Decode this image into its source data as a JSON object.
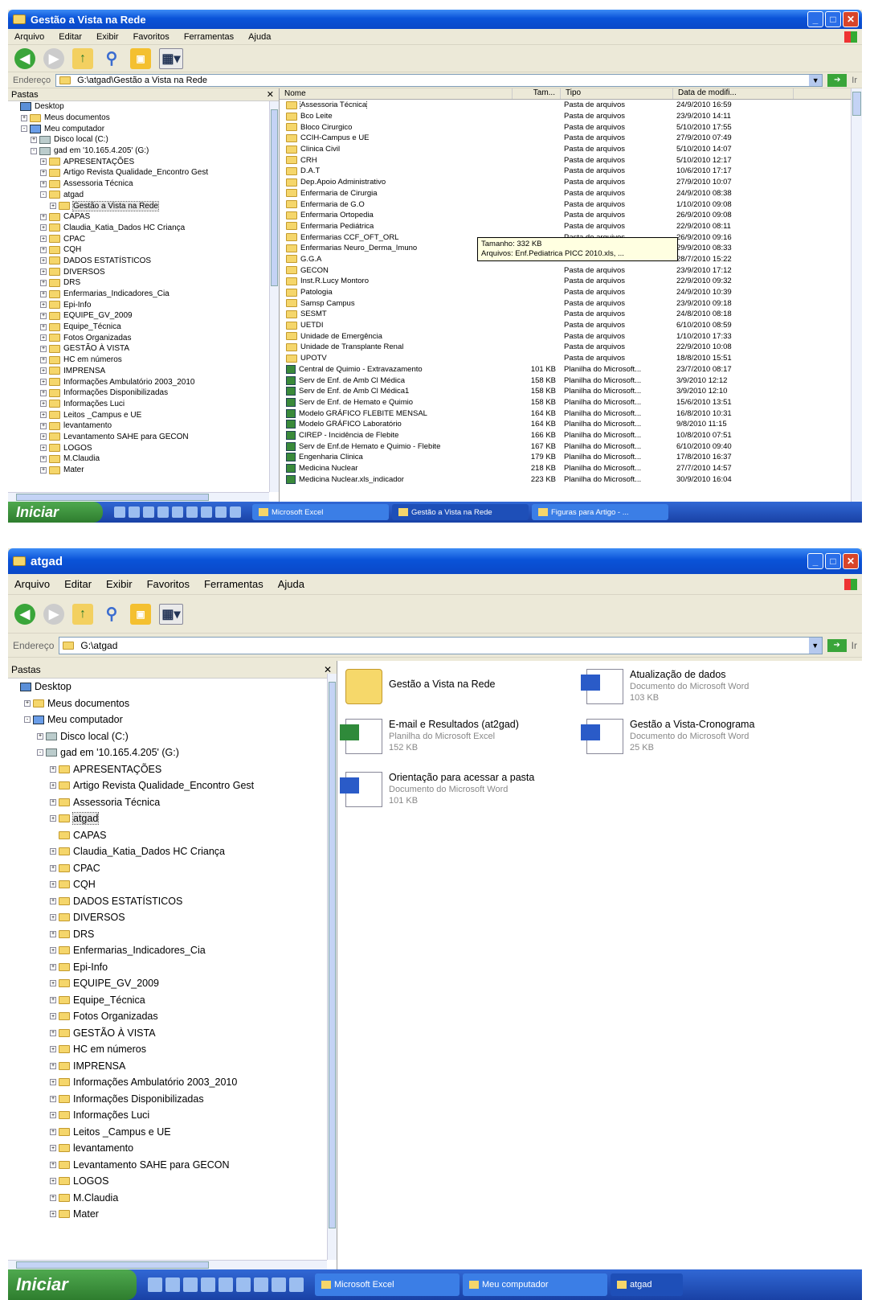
{
  "window1": {
    "title": "Gestão a Vista na Rede",
    "menu": [
      "Arquivo",
      "Editar",
      "Exibir",
      "Favoritos",
      "Ferramentas",
      "Ajuda"
    ],
    "address_label": "Endereço",
    "address": "G:\\atgad\\Gestão a Vista na Rede",
    "go_label": "Ir",
    "tree_header": "Pastas",
    "tree": [
      {
        "label": "Desktop",
        "level": 0,
        "icon": "desktop",
        "exp": ""
      },
      {
        "label": "Meus documentos",
        "level": 1,
        "icon": "folder",
        "exp": "+"
      },
      {
        "label": "Meu computador",
        "level": 1,
        "icon": "computer",
        "exp": "-"
      },
      {
        "label": "Disco local (C:)",
        "level": 2,
        "icon": "drive",
        "exp": "+"
      },
      {
        "label": "gad em '10.165.4.205' (G:)",
        "level": 2,
        "icon": "drive",
        "exp": "-"
      },
      {
        "label": "APRESENTAÇÕES",
        "level": 3,
        "icon": "folder",
        "exp": "+"
      },
      {
        "label": "Artigo Revista Qualidade_Encontro Gest",
        "level": 3,
        "icon": "folder",
        "exp": "+"
      },
      {
        "label": "Assessoria Técnica",
        "level": 3,
        "icon": "folder",
        "exp": "+"
      },
      {
        "label": "atgad",
        "level": 3,
        "icon": "folder",
        "exp": "-"
      },
      {
        "label": "Gestão a Vista na Rede",
        "level": 4,
        "icon": "folder",
        "exp": "+",
        "selected": true
      },
      {
        "label": "CAPAS",
        "level": 3,
        "icon": "folder",
        "exp": "+"
      },
      {
        "label": "Claudia_Katia_Dados HC Criança",
        "level": 3,
        "icon": "folder",
        "exp": "+"
      },
      {
        "label": "CPAC",
        "level": 3,
        "icon": "folder",
        "exp": "+"
      },
      {
        "label": "CQH",
        "level": 3,
        "icon": "folder",
        "exp": "+"
      },
      {
        "label": "DADOS ESTATÍSTICOS",
        "level": 3,
        "icon": "folder",
        "exp": "+"
      },
      {
        "label": "DIVERSOS",
        "level": 3,
        "icon": "folder",
        "exp": "+"
      },
      {
        "label": "DRS",
        "level": 3,
        "icon": "folder",
        "exp": "+"
      },
      {
        "label": "Enfermarias_Indicadores_Cia",
        "level": 3,
        "icon": "folder",
        "exp": "+"
      },
      {
        "label": "Epi-Info",
        "level": 3,
        "icon": "folder",
        "exp": "+"
      },
      {
        "label": "EQUIPE_GV_2009",
        "level": 3,
        "icon": "folder",
        "exp": "+"
      },
      {
        "label": "Equipe_Técnica",
        "level": 3,
        "icon": "folder",
        "exp": "+"
      },
      {
        "label": "Fotos Organizadas",
        "level": 3,
        "icon": "folder",
        "exp": "+"
      },
      {
        "label": "GESTÃO À VISTA",
        "level": 3,
        "icon": "folder",
        "exp": "+"
      },
      {
        "label": "HC em números",
        "level": 3,
        "icon": "folder",
        "exp": "+"
      },
      {
        "label": "IMPRENSA",
        "level": 3,
        "icon": "folder",
        "exp": "+"
      },
      {
        "label": "Informações Ambulatório 2003_2010",
        "level": 3,
        "icon": "folder",
        "exp": "+"
      },
      {
        "label": "Informações Disponibilizadas",
        "level": 3,
        "icon": "folder",
        "exp": "+"
      },
      {
        "label": "Informações Luci",
        "level": 3,
        "icon": "folder",
        "exp": "+"
      },
      {
        "label": "Leitos _Campus e UE",
        "level": 3,
        "icon": "folder",
        "exp": "+"
      },
      {
        "label": "levantamento",
        "level": 3,
        "icon": "folder",
        "exp": "+"
      },
      {
        "label": "Levantamento SAHE para GECON",
        "level": 3,
        "icon": "folder",
        "exp": "+"
      },
      {
        "label": "LOGOS",
        "level": 3,
        "icon": "folder",
        "exp": "+"
      },
      {
        "label": "M.Claudia",
        "level": 3,
        "icon": "folder",
        "exp": "+"
      },
      {
        "label": "Mater",
        "level": 3,
        "icon": "folder",
        "exp": "+"
      }
    ],
    "columns": [
      "Nome",
      "Tam...",
      "Tipo",
      "Data de modifi..."
    ],
    "files": [
      {
        "name": "Assessoria Técnica",
        "size": "",
        "type": "Pasta de arquivos",
        "date": "24/9/2010 16:59",
        "icon": "folder"
      },
      {
        "name": "Bco Leite",
        "size": "",
        "type": "Pasta de arquivos",
        "date": "23/9/2010 14:11",
        "icon": "folder"
      },
      {
        "name": "Bloco Cirurgico",
        "size": "",
        "type": "Pasta de arquivos",
        "date": "5/10/2010 17:55",
        "icon": "folder"
      },
      {
        "name": "CCIH-Campus e UE",
        "size": "",
        "type": "Pasta de arquivos",
        "date": "27/9/2010 07:49",
        "icon": "folder"
      },
      {
        "name": "Clinica Civil",
        "size": "",
        "type": "Pasta de arquivos",
        "date": "5/10/2010 14:07",
        "icon": "folder"
      },
      {
        "name": "CRH",
        "size": "",
        "type": "Pasta de arquivos",
        "date": "5/10/2010 12:17",
        "icon": "folder"
      },
      {
        "name": "D.A.T",
        "size": "",
        "type": "Pasta de arquivos",
        "date": "10/6/2010 17:17",
        "icon": "folder"
      },
      {
        "name": "Dep.Apoio Administrativo",
        "size": "",
        "type": "Pasta de arquivos",
        "date": "27/9/2010 10:07",
        "icon": "folder"
      },
      {
        "name": "Enfermaria de Cirurgia",
        "size": "",
        "type": "Pasta de arquivos",
        "date": "24/9/2010 08:38",
        "icon": "folder"
      },
      {
        "name": "Enfermaria de G.O",
        "size": "",
        "type": "Pasta de arquivos",
        "date": "1/10/2010 09:08",
        "icon": "folder"
      },
      {
        "name": "Enfermaria Ortopedia",
        "size": "",
        "type": "Pasta de arquivos",
        "date": "26/9/2010 09:08",
        "icon": "folder"
      },
      {
        "name": "Enfermaria Pediátrica",
        "size": "",
        "type": "Pasta de arquivos",
        "date": "22/9/2010 08:11",
        "icon": "folder"
      },
      {
        "name": "Enfermarias CCF_OFT_ORL",
        "size": "",
        "type": "Pasta de arquivos",
        "date": "26/9/2010 09:16",
        "icon": "folder"
      },
      {
        "name": "Enfermarias Neuro_Derma_Imuno",
        "size": "",
        "type": "",
        "date": "29/9/2010 08:33",
        "icon": "folder"
      },
      {
        "name": "G.G.A",
        "size": "",
        "type": "",
        "date": "28/7/2010 15:22",
        "icon": "folder"
      },
      {
        "name": "GECON",
        "size": "",
        "type": "Pasta de arquivos",
        "date": "23/9/2010 17:12",
        "icon": "folder"
      },
      {
        "name": "Inst.R.Lucy Montoro",
        "size": "",
        "type": "Pasta de arquivos",
        "date": "22/9/2010 09:32",
        "icon": "folder"
      },
      {
        "name": "Patologia",
        "size": "",
        "type": "Pasta de arquivos",
        "date": "24/9/2010 10:39",
        "icon": "folder"
      },
      {
        "name": "Samsp Campus",
        "size": "",
        "type": "Pasta de arquivos",
        "date": "23/9/2010 09:18",
        "icon": "folder"
      },
      {
        "name": "SESMT",
        "size": "",
        "type": "Pasta de arquivos",
        "date": "24/8/2010 08:18",
        "icon": "folder"
      },
      {
        "name": "UETDI",
        "size": "",
        "type": "Pasta de arquivos",
        "date": "6/10/2010 08:59",
        "icon": "folder"
      },
      {
        "name": "Unidade de Emergência",
        "size": "",
        "type": "Pasta de arquivos",
        "date": "1/10/2010 17:33",
        "icon": "folder"
      },
      {
        "name": "Unidade de Transplante Renal",
        "size": "",
        "type": "Pasta de arquivos",
        "date": "22/9/2010 10:08",
        "icon": "folder"
      },
      {
        "name": "UPOTV",
        "size": "",
        "type": "Pasta de arquivos",
        "date": "18/8/2010 15:51",
        "icon": "folder"
      },
      {
        "name": "Central de Quimio - Extravazamento",
        "size": "101 KB",
        "type": "Planilha do Microsoft...",
        "date": "23/7/2010 08:17",
        "icon": "xls"
      },
      {
        "name": "Serv de Enf. de Amb Cl Médica",
        "size": "158 KB",
        "type": "Planilha do Microsoft...",
        "date": "3/9/2010 12:12",
        "icon": "xls"
      },
      {
        "name": "Serv de Enf. de Amb Cl Médica1",
        "size": "158 KB",
        "type": "Planilha do Microsoft...",
        "date": "3/9/2010 12:10",
        "icon": "xls"
      },
      {
        "name": "Serv de Enf. de Hemato e Quimio",
        "size": "158 KB",
        "type": "Planilha do Microsoft...",
        "date": "15/6/2010 13:51",
        "icon": "xls"
      },
      {
        "name": "Modelo GRÁFICO FLEBITE MENSAL",
        "size": "164 KB",
        "type": "Planilha do Microsoft...",
        "date": "16/8/2010 10:31",
        "icon": "xls"
      },
      {
        "name": "Modelo GRÁFICO Laboratório",
        "size": "164 KB",
        "type": "Planilha do Microsoft...",
        "date": "9/8/2010 11:15",
        "icon": "xls"
      },
      {
        "name": "CIREP - Incidência de Flebite",
        "size": "166 KB",
        "type": "Planilha do Microsoft...",
        "date": "10/8/2010 07:51",
        "icon": "xls"
      },
      {
        "name": "Serv de Enf.de Hemato e Quimio - Flebite",
        "size": "167 KB",
        "type": "Planilha do Microsoft...",
        "date": "6/10/2010 09:40",
        "icon": "xls"
      },
      {
        "name": "Engenharia Clinica",
        "size": "179 KB",
        "type": "Planilha do Microsoft...",
        "date": "17/8/2010 16:37",
        "icon": "xls"
      },
      {
        "name": "Medicina Nuclear",
        "size": "218 KB",
        "type": "Planilha do Microsoft...",
        "date": "27/7/2010 14:57",
        "icon": "xls"
      },
      {
        "name": "Medicina Nuclear.xls_indicador",
        "size": "223 KB",
        "type": "Planilha do Microsoft...",
        "date": "30/9/2010 16:04",
        "icon": "xls"
      }
    ],
    "tooltip": {
      "line1": "Tamanho: 332 KB",
      "line2": "Arquivos: Enf.Pediatrica PICC 2010.xls, ..."
    },
    "taskbar": {
      "start": "Iniciar",
      "buttons": [
        "Microsoft Excel",
        "Gestão a Vista na Rede",
        "Figuras para Artigo - ..."
      ]
    }
  },
  "window2": {
    "title": "atgad",
    "menu": [
      "Arquivo",
      "Editar",
      "Exibir",
      "Favoritos",
      "Ferramentas",
      "Ajuda"
    ],
    "address_label": "Endereço",
    "address": "G:\\atgad",
    "go_label": "Ir",
    "tree_header": "Pastas",
    "tree": [
      {
        "label": "Desktop",
        "level": 0,
        "icon": "desktop",
        "exp": ""
      },
      {
        "label": "Meus documentos",
        "level": 1,
        "icon": "folder",
        "exp": "+"
      },
      {
        "label": "Meu computador",
        "level": 1,
        "icon": "computer",
        "exp": "-"
      },
      {
        "label": "Disco local (C:)",
        "level": 2,
        "icon": "drive",
        "exp": "+"
      },
      {
        "label": "gad em '10.165.4.205' (G:)",
        "level": 2,
        "icon": "drive",
        "exp": "-"
      },
      {
        "label": "APRESENTAÇÕES",
        "level": 3,
        "icon": "folder",
        "exp": "+"
      },
      {
        "label": "Artigo Revista Qualidade_Encontro Gest",
        "level": 3,
        "icon": "folder",
        "exp": "+"
      },
      {
        "label": "Assessoria Técnica",
        "level": 3,
        "icon": "folder",
        "exp": "+"
      },
      {
        "label": "atgad",
        "level": 3,
        "icon": "folder",
        "exp": "+",
        "selected": true
      },
      {
        "label": "CAPAS",
        "level": 3,
        "icon": "folder",
        "exp": ""
      },
      {
        "label": "Claudia_Katia_Dados HC Criança",
        "level": 3,
        "icon": "folder",
        "exp": "+"
      },
      {
        "label": "CPAC",
        "level": 3,
        "icon": "folder",
        "exp": "+"
      },
      {
        "label": "CQH",
        "level": 3,
        "icon": "folder",
        "exp": "+"
      },
      {
        "label": "DADOS ESTATÍSTICOS",
        "level": 3,
        "icon": "folder",
        "exp": "+"
      },
      {
        "label": "DIVERSOS",
        "level": 3,
        "icon": "folder",
        "exp": "+"
      },
      {
        "label": "DRS",
        "level": 3,
        "icon": "folder",
        "exp": "+"
      },
      {
        "label": "Enfermarias_Indicadores_Cia",
        "level": 3,
        "icon": "folder",
        "exp": "+"
      },
      {
        "label": "Epi-Info",
        "level": 3,
        "icon": "folder",
        "exp": "+"
      },
      {
        "label": "EQUIPE_GV_2009",
        "level": 3,
        "icon": "folder",
        "exp": "+"
      },
      {
        "label": "Equipe_Técnica",
        "level": 3,
        "icon": "folder",
        "exp": "+"
      },
      {
        "label": "Fotos Organizadas",
        "level": 3,
        "icon": "folder",
        "exp": "+"
      },
      {
        "label": "GESTÃO À VISTA",
        "level": 3,
        "icon": "folder",
        "exp": "+"
      },
      {
        "label": "HC em números",
        "level": 3,
        "icon": "folder",
        "exp": "+"
      },
      {
        "label": "IMPRENSA",
        "level": 3,
        "icon": "folder",
        "exp": "+"
      },
      {
        "label": "Informações Ambulatório 2003_2010",
        "level": 3,
        "icon": "folder",
        "exp": "+"
      },
      {
        "label": "Informações Disponibilizadas",
        "level": 3,
        "icon": "folder",
        "exp": "+"
      },
      {
        "label": "Informações Luci",
        "level": 3,
        "icon": "folder",
        "exp": "+"
      },
      {
        "label": "Leitos _Campus e UE",
        "level": 3,
        "icon": "folder",
        "exp": "+"
      },
      {
        "label": "levantamento",
        "level": 3,
        "icon": "folder",
        "exp": "+"
      },
      {
        "label": "Levantamento SAHE para GECON",
        "level": 3,
        "icon": "folder",
        "exp": "+"
      },
      {
        "label": "LOGOS",
        "level": 3,
        "icon": "folder",
        "exp": "+"
      },
      {
        "label": "M.Claudia",
        "level": 3,
        "icon": "folder",
        "exp": "+"
      },
      {
        "label": "Mater",
        "level": 3,
        "icon": "folder",
        "exp": "+"
      }
    ],
    "items": [
      {
        "name": "Gestão a Vista na Rede",
        "line2": "",
        "line3": "",
        "icon": "folder"
      },
      {
        "name": "Atualização de dados",
        "line2": "Documento do Microsoft Word",
        "line3": "103 KB",
        "icon": "doc"
      },
      {
        "name": "E-mail e Resultados (at2gad)",
        "line2": "Planilha do Microsoft Excel",
        "line3": "152 KB",
        "icon": "xls"
      },
      {
        "name": "Gestão a Vista-Cronograma",
        "line2": "Documento do Microsoft Word",
        "line3": "25 KB",
        "icon": "doc"
      },
      {
        "name": "Orientação para acessar a pasta",
        "line2": "Documento do Microsoft Word",
        "line3": "101 KB",
        "icon": "doc"
      }
    ],
    "taskbar": {
      "start": "Iniciar",
      "buttons": [
        "Microsoft Excel",
        "Meu computador",
        "atgad"
      ]
    }
  }
}
